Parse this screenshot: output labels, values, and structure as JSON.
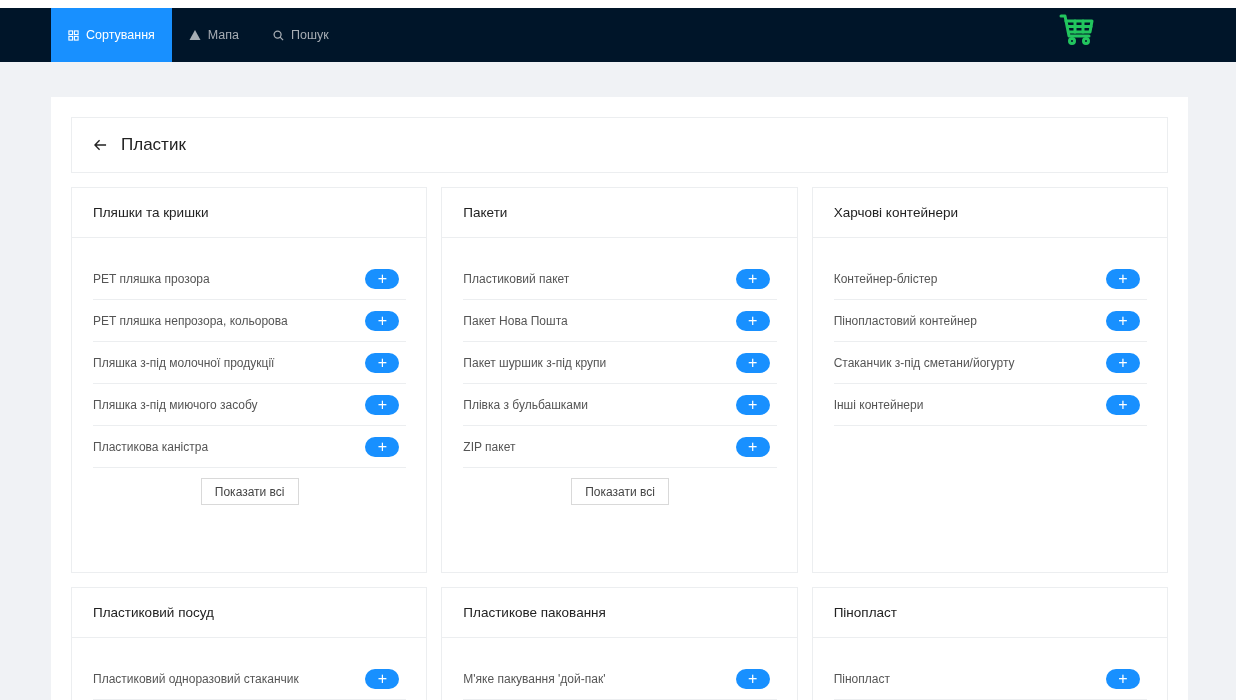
{
  "nav": {
    "tabs": [
      {
        "label": "Сортування",
        "selected": true
      },
      {
        "label": "Мапа",
        "selected": false
      },
      {
        "label": "Пошук",
        "selected": false
      }
    ]
  },
  "page": {
    "title": "Пластик"
  },
  "categories": [
    {
      "title": "Пляшки та кришки",
      "items": [
        {
          "name": "PET пляшка прозора",
          "action": "+"
        },
        {
          "name": "PET пляшка непрозора, кольорова",
          "action": "+"
        },
        {
          "name": "Пляшка з-під молочної продукції",
          "action": "+"
        },
        {
          "name": "Пляшка з-під миючого засобу",
          "action": "+"
        },
        {
          "name": "Пластикова каністра",
          "action": "+"
        }
      ],
      "show_all": "Показати всі"
    },
    {
      "title": "Пакети",
      "items": [
        {
          "name": "Пластиковий пакет",
          "action": "+"
        },
        {
          "name": "Пакет Нова Пошта",
          "action": "+"
        },
        {
          "name": "Пакет шуршик з-під крупи",
          "action": "+"
        },
        {
          "name": "Плівка з бульбашками",
          "action": "+"
        },
        {
          "name": "ZIP пакет",
          "action": "+"
        }
      ],
      "show_all": "Показати всі"
    },
    {
      "title": "Харчові контейнери",
      "items": [
        {
          "name": "Контейнер-блістер",
          "action": "+"
        },
        {
          "name": "Пінопластовий контейнер",
          "action": "+"
        },
        {
          "name": "Стаканчик з-під сметани/йогурту",
          "action": "+"
        },
        {
          "name": "Інші контейнери",
          "action": "+"
        }
      ]
    },
    {
      "title": "Пластиковий посуд",
      "items": [
        {
          "name": "Пластиковий одноразовий стаканчик",
          "action": "+"
        }
      ]
    },
    {
      "title": "Пластикове паковання",
      "items": [
        {
          "name": "М'яке пакування 'дой-пак'",
          "action": "+"
        }
      ]
    },
    {
      "title": "Пінопласт",
      "items": [
        {
          "name": "Пінопласт",
          "action": "+"
        }
      ]
    }
  ]
}
